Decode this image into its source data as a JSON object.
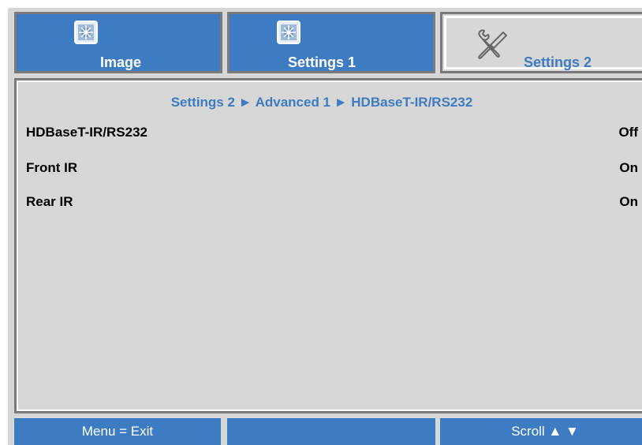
{
  "tabs": [
    {
      "label": "Image",
      "icon": "image-tab-icon",
      "active": false
    },
    {
      "label": "Settings 1",
      "icon": "settings1-tab-icon",
      "active": false
    },
    {
      "label": "Settings 2",
      "icon": "tools-icon",
      "active": true
    }
  ],
  "breadcrumb": "Settings 2 ► Advanced 1 ► HDBaseT-IR/RS232",
  "menu": {
    "items": [
      {
        "label": "HDBaseT-IR/RS232",
        "value": "Off"
      },
      {
        "label": "Front IR",
        "value": "On"
      },
      {
        "label": "Rear IR",
        "value": "On"
      }
    ]
  },
  "footer": {
    "left": "Menu = Exit",
    "middle": "",
    "right": "Scroll ▲ ▼"
  },
  "colors": {
    "accent": "#3d7cc2",
    "panel": "#d7d7d7",
    "border": "#7a7a7a"
  }
}
